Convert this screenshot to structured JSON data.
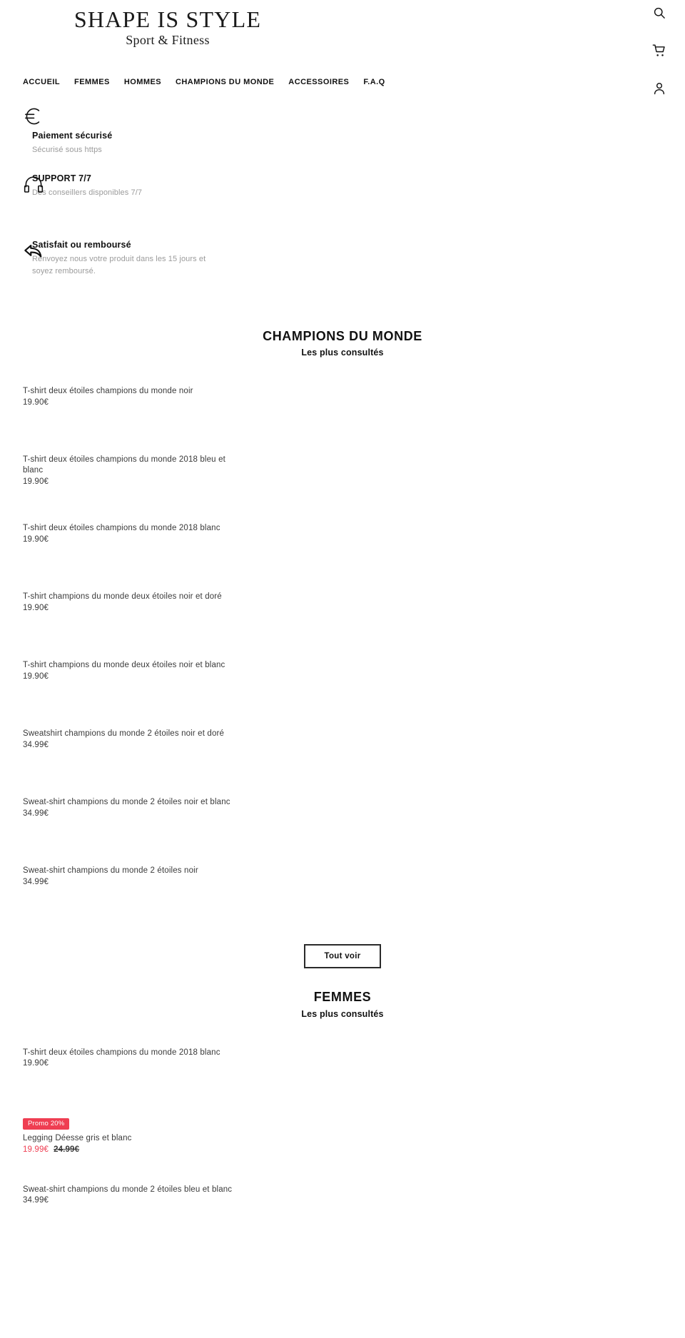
{
  "header": {
    "brand_name": "SHAPE IS STYLE",
    "brand_tagline": "Sport & Fitness",
    "util_icons": [
      {
        "name": "search-icon",
        "label": "Rechercher"
      },
      {
        "name": "cart-icon",
        "label": "Panier"
      },
      {
        "name": "account-icon",
        "label": "Compte"
      }
    ],
    "nav": [
      {
        "label": "ACCUEIL"
      },
      {
        "label": "FEMMES"
      },
      {
        "label": "HOMMES"
      },
      {
        "label": "CHAMPIONS DU MONDE"
      },
      {
        "label": "ACCESSOIRES"
      },
      {
        "label": "F.A.Q"
      }
    ]
  },
  "trust": [
    {
      "icon": "euro-icon",
      "title": "Paiement sécurisé",
      "subtitle": "Sécurisé sous https"
    },
    {
      "icon": "headset-icon",
      "title": "SUPPORT 7/7",
      "subtitle": "Des conseillers disponibles 7/7"
    },
    {
      "icon": "return-arrow-icon",
      "title": "Satisfait ou remboursé",
      "subtitle": "Renvoyez nous votre produit dans les 15 jours et soyez remboursé."
    }
  ],
  "sections": [
    {
      "title": "CHAMPIONS DU MONDE",
      "subtitle": "Les plus consultés",
      "cta_label": "Tout voir",
      "products": [
        {
          "title": "T-shirt deux étoiles champions du monde noir",
          "price": "19.90€"
        },
        {
          "title": "T-shirt deux étoiles champions du monde 2018 bleu et blanc",
          "price": "19.90€"
        },
        {
          "title": "T-shirt deux étoiles champions du monde 2018 blanc",
          "price": "19.90€"
        },
        {
          "title": "T-shirt champions du monde deux étoiles noir et doré",
          "price": "19.90€"
        },
        {
          "title": "T-shirt champions du monde deux étoiles noir et blanc",
          "price": "19.90€"
        },
        {
          "title": "Sweatshirt champions du monde 2 étoiles noir et doré",
          "price": "34.99€"
        },
        {
          "title": "Sweat-shirt champions du monde 2 étoiles noir et blanc",
          "price": "34.99€"
        },
        {
          "title": "Sweat-shirt champions du monde 2 étoiles noir",
          "price": "34.99€"
        }
      ]
    },
    {
      "title": "FEMMES",
      "subtitle": "Les plus consultés",
      "cta_label": "",
      "products": [
        {
          "title": "T-shirt deux étoiles champions du monde 2018 blanc",
          "price": "19.90€"
        },
        {
          "title": "Legging Déesse gris et blanc",
          "price": "19.99€",
          "old_price": "24.99€",
          "badge": "Promo 20%"
        },
        {
          "title": "Sweat-shirt champions du monde 2 étoiles bleu et blanc",
          "price": "34.99€"
        }
      ]
    }
  ],
  "colors": {
    "promo_red": "#ef3e52",
    "text_dark": "#111111",
    "text_body": "#3a3a3a",
    "text_muted": "#9b9b9b"
  }
}
